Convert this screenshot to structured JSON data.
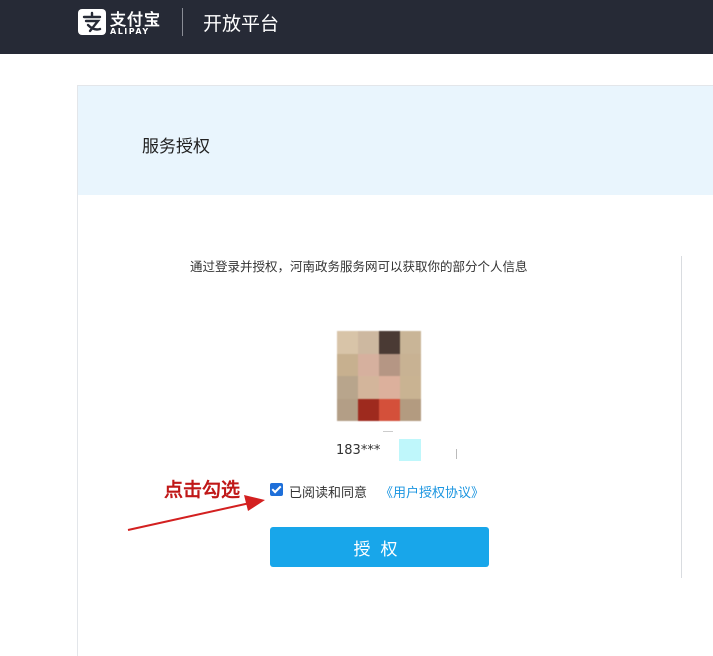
{
  "header": {
    "logo_text": "支付宝",
    "logo_sub": "ALIPAY",
    "platform_title": "开放平台"
  },
  "card": {
    "title": "服务授权",
    "notice": "通过登录并授权，河南政务服务网可以获取你的部分个人信息",
    "phone_prefix": "183***",
    "agree_text": "已阅读和同意",
    "agree_link": "《用户授权协议》",
    "agree_checked": true,
    "auth_button": "授权"
  },
  "annotation": {
    "text": "点击勾选",
    "color": "#c01818"
  },
  "colors": {
    "topbar": "#262a36",
    "header_bg": "#e9f5fd",
    "button": "#18a6ea",
    "link": "#1a95e0"
  }
}
